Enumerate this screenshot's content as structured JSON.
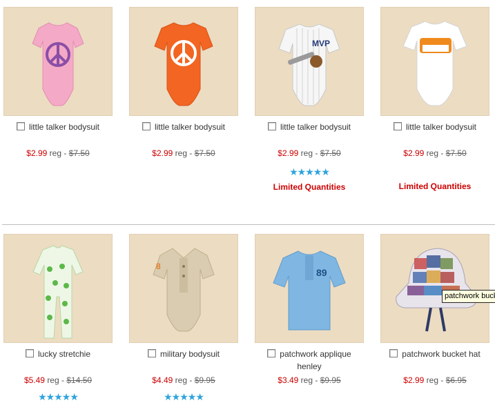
{
  "products": [
    {
      "title": "little talker bodysuit",
      "sale": "$2.99",
      "reg_label": "reg -",
      "reg": "$7.50",
      "stars": "",
      "limited": ""
    },
    {
      "title": "little talker bodysuit",
      "sale": "$2.99",
      "reg_label": "reg -",
      "reg": "$7.50",
      "stars": "",
      "limited": ""
    },
    {
      "title": "little talker bodysuit",
      "sale": "$2.99",
      "reg_label": "reg -",
      "reg": "$7.50",
      "stars": "★★★★★",
      "limited": "Limited Quantities"
    },
    {
      "title": "little talker bodysuit",
      "sale": "$2.99",
      "reg_label": "reg -",
      "reg": "$7.50",
      "stars": "",
      "limited": "Limited Quantities"
    },
    {
      "title": "lucky stretchie",
      "sale": "$5.49",
      "reg_label": "reg -",
      "reg": "$14.50",
      "stars": "★★★★★",
      "limited": ""
    },
    {
      "title": "military bodysuit",
      "sale": "$4.49",
      "reg_label": "reg -",
      "reg": "$9.95",
      "stars": "★★★★★",
      "limited": ""
    },
    {
      "title": "patchwork applique henley",
      "sale": "$3.49",
      "reg_label": "reg -",
      "reg": "$9.95",
      "stars": "",
      "limited": ""
    },
    {
      "title": "patchwork bucket hat",
      "sale": "$2.99",
      "reg_label": "reg -",
      "reg": "$6.95",
      "stars": "",
      "limited": ""
    }
  ],
  "tooltip": "patchwork bucket hat",
  "colors": {
    "sale": "#cc0000",
    "stars": "#2fa3dc",
    "thumb_bg": "#ecdcc2"
  }
}
